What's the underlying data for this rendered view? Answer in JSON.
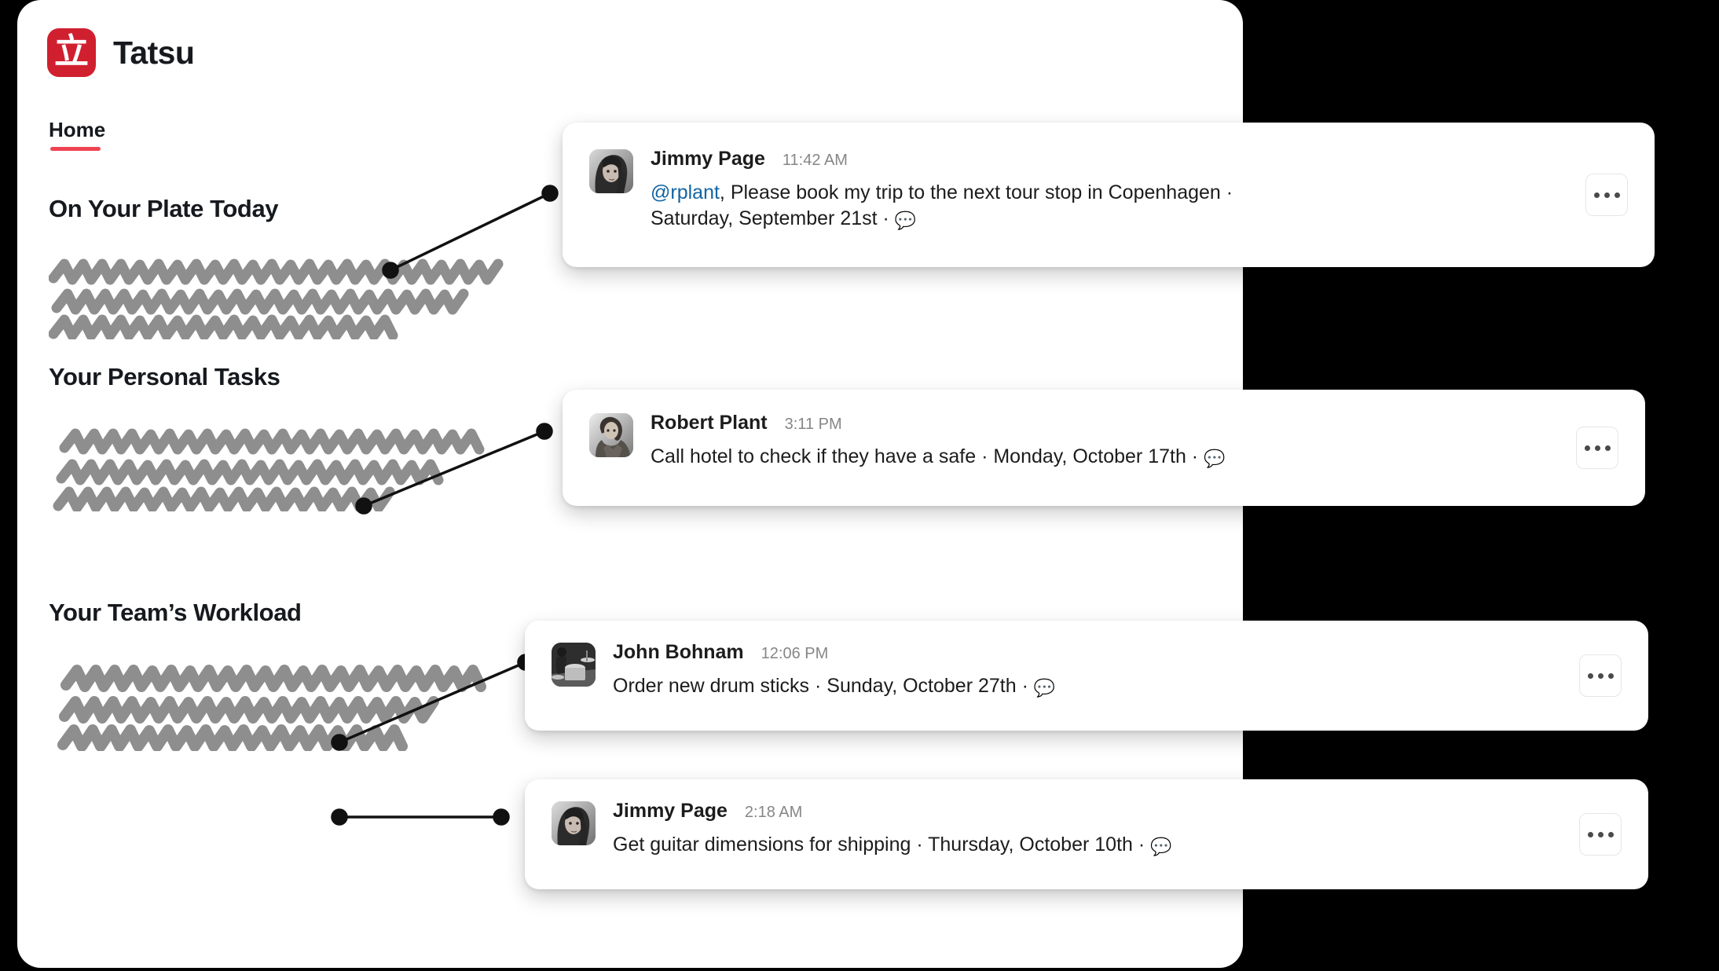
{
  "app": {
    "title": "Tatsu",
    "logo_glyph": "立",
    "logo_color": "#d0202f",
    "accent_color": "#ef4352"
  },
  "nav": {
    "tabs": [
      {
        "label": "Home",
        "active": true
      }
    ]
  },
  "sections": [
    {
      "id": "on-your-plate-today",
      "title": "On Your Plate Today"
    },
    {
      "id": "your-personal-tasks",
      "title": "Your Personal Tasks"
    },
    {
      "id": "your-teams-workload",
      "title": "Your Team’s Workload"
    }
  ],
  "cards": [
    {
      "author": "Jimmy Page",
      "time": "11:42 AM",
      "mention": "@rplant",
      "text_after_mention": ", Please book my trip to the next tour stop in Copenhagen · Saturday, September 21st · ",
      "bubble": "💬",
      "overflow_label": "…",
      "avatar_name": "jimmy-page-avatar"
    },
    {
      "author": "Robert Plant",
      "time": "3:11 PM",
      "text": "Call hotel to check if they have a safe · Monday, October 17th · ",
      "bubble": "💬",
      "overflow_label": "…",
      "avatar_name": "robert-plant-avatar"
    },
    {
      "author": "John Bohnam",
      "time": "12:06 PM",
      "text": "Order new drum sticks · Sunday, October 27th · ",
      "bubble": "💬",
      "overflow_label": "…",
      "avatar_name": "john-bohnam-avatar"
    },
    {
      "author": "Jimmy Page",
      "time": "2:18 AM",
      "text": "Get guitar dimensions for shipping · Thursday, October 10th · ",
      "bubble": "💬",
      "overflow_label": "…",
      "avatar_name": "jimmy-page-avatar-2"
    }
  ]
}
